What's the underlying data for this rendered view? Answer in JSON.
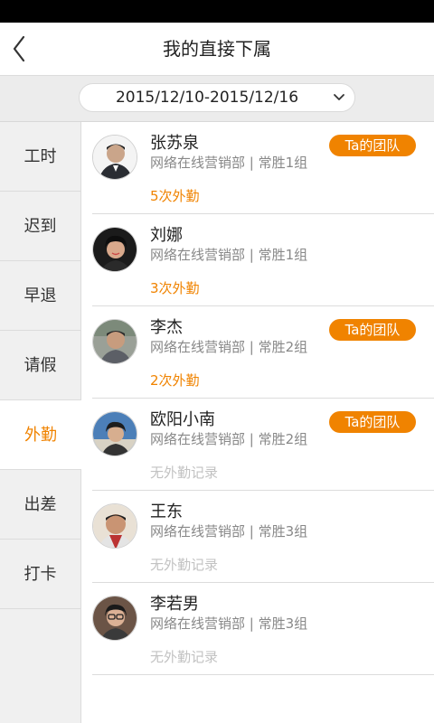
{
  "header": {
    "title": "我的直接下属"
  },
  "date_range": {
    "label": "2015/12/10-2015/12/16"
  },
  "sidebar": {
    "items": [
      {
        "label": "工时",
        "active": false
      },
      {
        "label": "迟到",
        "active": false
      },
      {
        "label": "早退",
        "active": false
      },
      {
        "label": "请假",
        "active": false
      },
      {
        "label": "外勤",
        "active": true
      },
      {
        "label": "出差",
        "active": false
      },
      {
        "label": "打卡",
        "active": false
      }
    ]
  },
  "list": {
    "people": [
      {
        "name": "张苏泉",
        "dept": "网络在线营销部 | 常胜1组",
        "count": "5次外勤",
        "has_records": true,
        "badge": "Ta的团队"
      },
      {
        "name": "刘娜",
        "dept": "网络在线营销部 | 常胜1组",
        "count": "3次外勤",
        "has_records": true,
        "badge": ""
      },
      {
        "name": "李杰",
        "dept": "网络在线营销部 | 常胜2组",
        "count": "2次外勤",
        "has_records": true,
        "badge": "Ta的团队"
      },
      {
        "name": "欧阳小南",
        "dept": "网络在线营销部 | 常胜2组",
        "count": "无外勤记录",
        "has_records": false,
        "badge": "Ta的团队"
      },
      {
        "name": "王东",
        "dept": "网络在线营销部 | 常胜3组",
        "count": "无外勤记录",
        "has_records": false,
        "badge": ""
      },
      {
        "name": "李若男",
        "dept": "网络在线营销部 | 常胜3组",
        "count": "无外勤记录",
        "has_records": false,
        "badge": ""
      }
    ]
  },
  "colors": {
    "accent": "#f08300",
    "muted": "#c2c2c2"
  },
  "icons": {
    "back": "chevron-left-icon",
    "dropdown": "chevron-down-icon"
  }
}
